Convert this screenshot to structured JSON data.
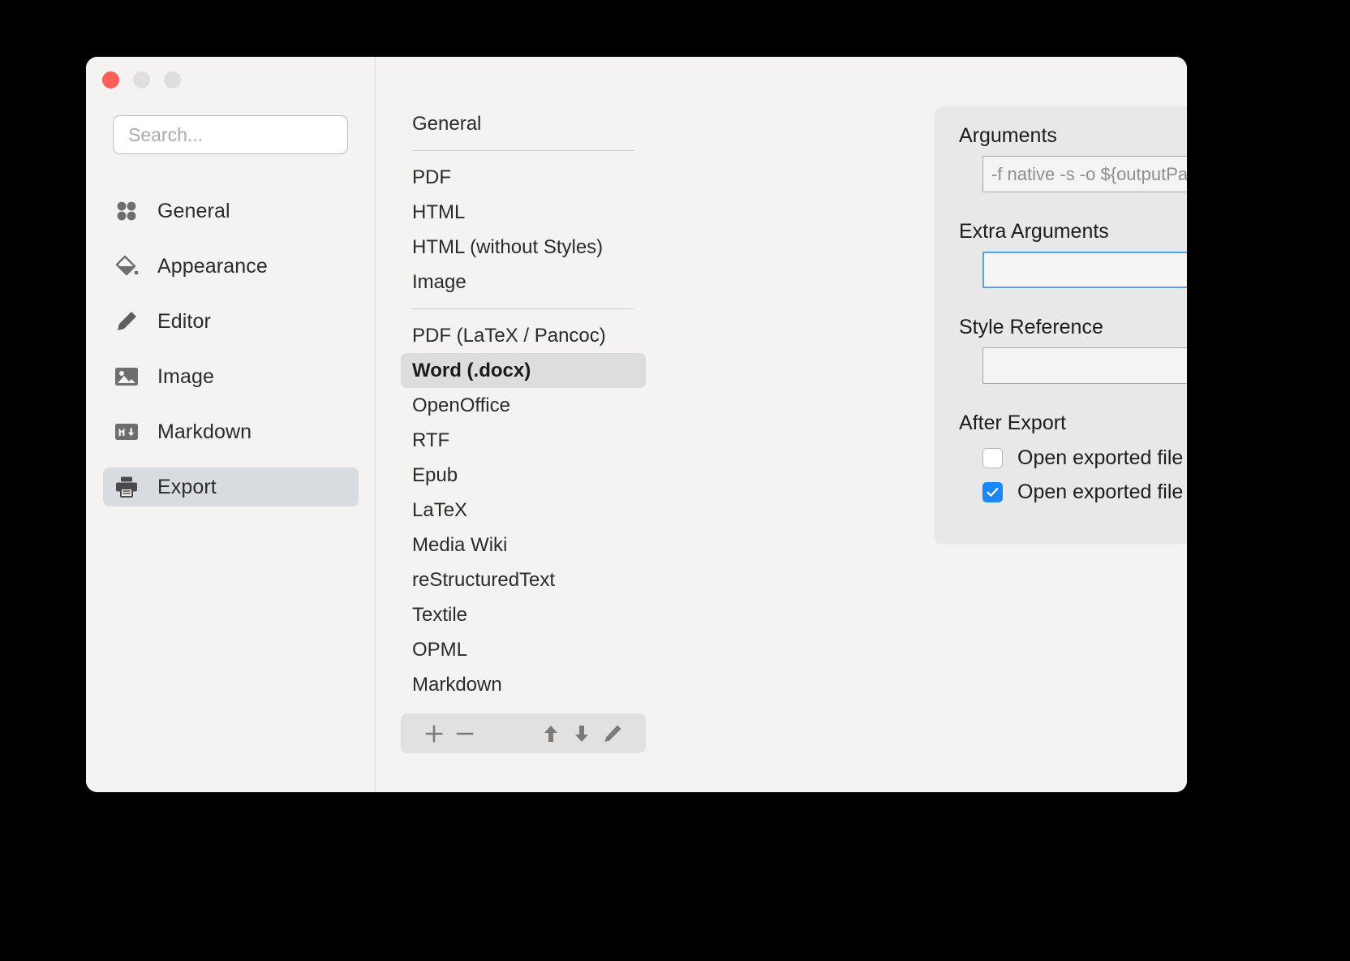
{
  "window": {
    "traffic_lights": [
      "close",
      "minimize",
      "maximize"
    ],
    "colors": {
      "close": "#FC5F57",
      "minimize": "#DEDEDE",
      "maximize": "#DEDEDE",
      "accent": "#1C86FB",
      "focus_ring": "#5AA2E8",
      "sidebar_bg": "#F4F3F1",
      "sidebar_selected": "#D8DCE0",
      "list_selected": "#DDDDDD",
      "panel_bg": "#E8E8E8"
    }
  },
  "search": {
    "placeholder": "Search...",
    "value": ""
  },
  "sidebar": {
    "items": [
      {
        "label": "General",
        "icon": "four-dots-icon",
        "selected": false
      },
      {
        "label": "Appearance",
        "icon": "paint-bucket-icon",
        "selected": false
      },
      {
        "label": "Editor",
        "icon": "pencil-icon",
        "selected": false
      },
      {
        "label": "Image",
        "icon": "picture-icon",
        "selected": false
      },
      {
        "label": "Markdown",
        "icon": "markdown-icon",
        "selected": false
      },
      {
        "label": "Export",
        "icon": "printer-icon",
        "selected": true
      }
    ]
  },
  "export_list": {
    "groups": [
      {
        "items": [
          {
            "label": "General",
            "selected": false
          }
        ]
      },
      {
        "items": [
          {
            "label": "PDF",
            "selected": false
          },
          {
            "label": "HTML",
            "selected": false
          },
          {
            "label": "HTML (without Styles)",
            "selected": false
          },
          {
            "label": "Image",
            "selected": false
          }
        ]
      },
      {
        "items": [
          {
            "label": "PDF (LaTeX / Pancoc)",
            "selected": false
          },
          {
            "label": "Word (.docx)",
            "selected": true
          },
          {
            "label": "OpenOffice",
            "selected": false
          },
          {
            "label": "RTF",
            "selected": false
          },
          {
            "label": "Epub",
            "selected": false
          },
          {
            "label": "LaTeX",
            "selected": false
          },
          {
            "label": "Media Wiki",
            "selected": false
          },
          {
            "label": "reStructuredText",
            "selected": false
          },
          {
            "label": "Textile",
            "selected": false
          },
          {
            "label": "OPML",
            "selected": false
          },
          {
            "label": "Markdown",
            "selected": false
          }
        ]
      }
    ],
    "toolbar": [
      {
        "name": "add-button",
        "glyph": "+"
      },
      {
        "name": "remove-button",
        "glyph": "−"
      },
      {
        "name": "move-up-button",
        "glyph": "↑"
      },
      {
        "name": "move-down-button",
        "glyph": "↓"
      },
      {
        "name": "edit-button",
        "glyph": "✎"
      }
    ]
  },
  "form": {
    "arguments": {
      "label": "Arguments",
      "value": "",
      "placeholder": "-f native -s -o ${outputPath} -t docx",
      "disabled": true
    },
    "extra_arguments": {
      "label": "Extra Arguments",
      "value": "",
      "placeholder": "",
      "focused": true
    },
    "style_reference": {
      "label": "Style Reference",
      "value": "",
      "placeholder": "",
      "browse_icon": "folder-icon"
    },
    "after_export": {
      "label": "After Export",
      "options": [
        {
          "label": "Open exported file location",
          "checked": false
        },
        {
          "label": "Open exported file",
          "checked": true
        }
      ]
    }
  }
}
